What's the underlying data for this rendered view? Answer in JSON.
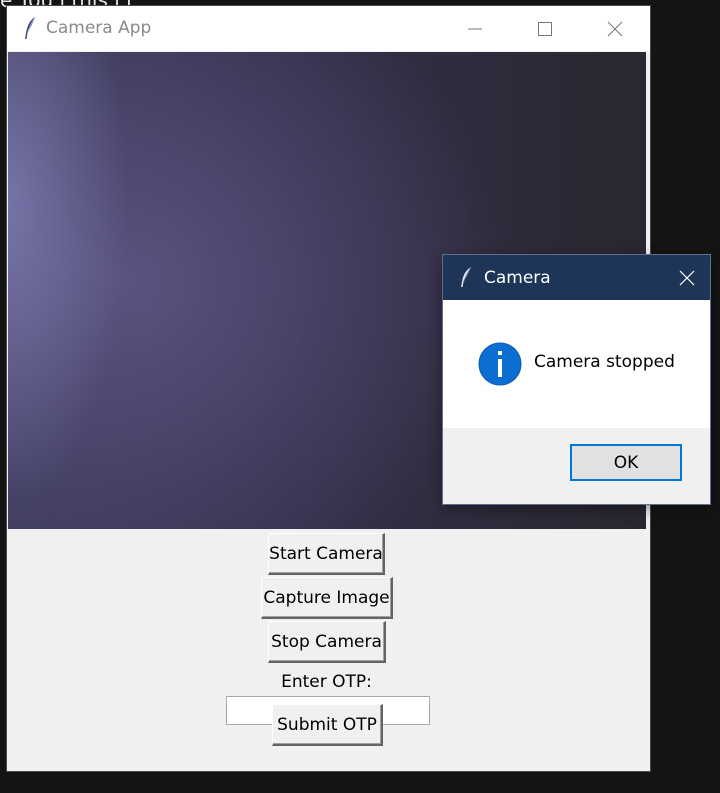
{
  "background": {
    "text": "e  You    l    this  i  l"
  },
  "main_window": {
    "title": "Camera App",
    "buttons": {
      "start": "Start Camera",
      "capture": "Capture Image",
      "stop": "Stop Camera",
      "submit": "Submit OTP"
    },
    "otp_label": "Enter OTP:",
    "otp_value": ""
  },
  "dialog": {
    "title": "Camera",
    "message": "Camera stopped",
    "ok_label": "OK",
    "icon": "info-icon"
  },
  "colors": {
    "dialog_titlebar": "#1e3557",
    "info_icon": "#0a6fd1",
    "ok_border": "#0078d7"
  }
}
